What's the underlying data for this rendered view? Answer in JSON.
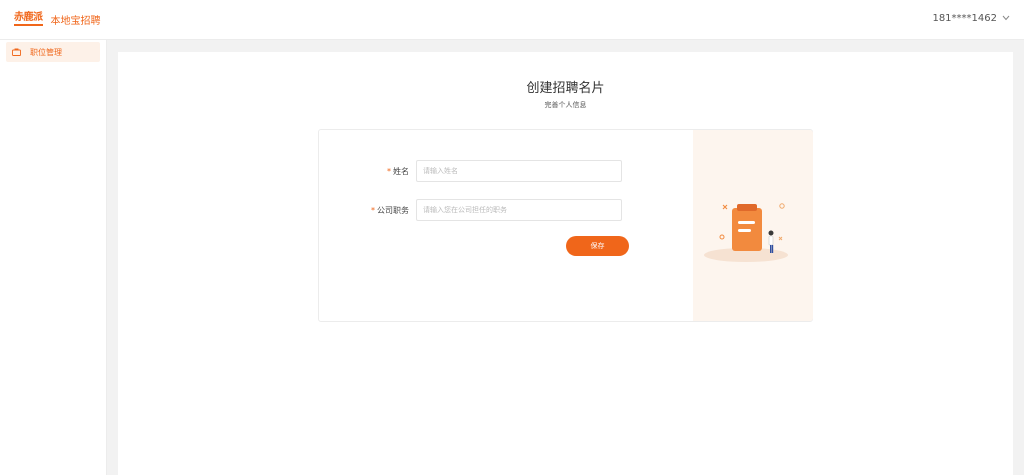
{
  "header": {
    "logo_mark": "赤鹿派",
    "app_name": "本地宝招聘",
    "user_phone": "181****1462",
    "user_menu_icon": "chevron-down-icon"
  },
  "sidebar": {
    "items": [
      {
        "label": "职位管理",
        "icon": "briefcase-icon",
        "active": true
      }
    ]
  },
  "main": {
    "title": "创建招聘名片",
    "subtitle": "完善个人信息",
    "form": {
      "name": {
        "label": "姓名",
        "required_mark": "*",
        "value": "",
        "placeholder": "请输入姓名"
      },
      "position": {
        "label": "公司职务",
        "required_mark": "*",
        "value": "",
        "placeholder": "请输入您在公司担任的职务"
      },
      "save_label": "保存"
    },
    "illustration": "clipboard-person-illustration"
  },
  "colors": {
    "accent": "#f0661a",
    "panel_bg": "#fdf5ee",
    "page_bg": "#f2f2f2"
  }
}
